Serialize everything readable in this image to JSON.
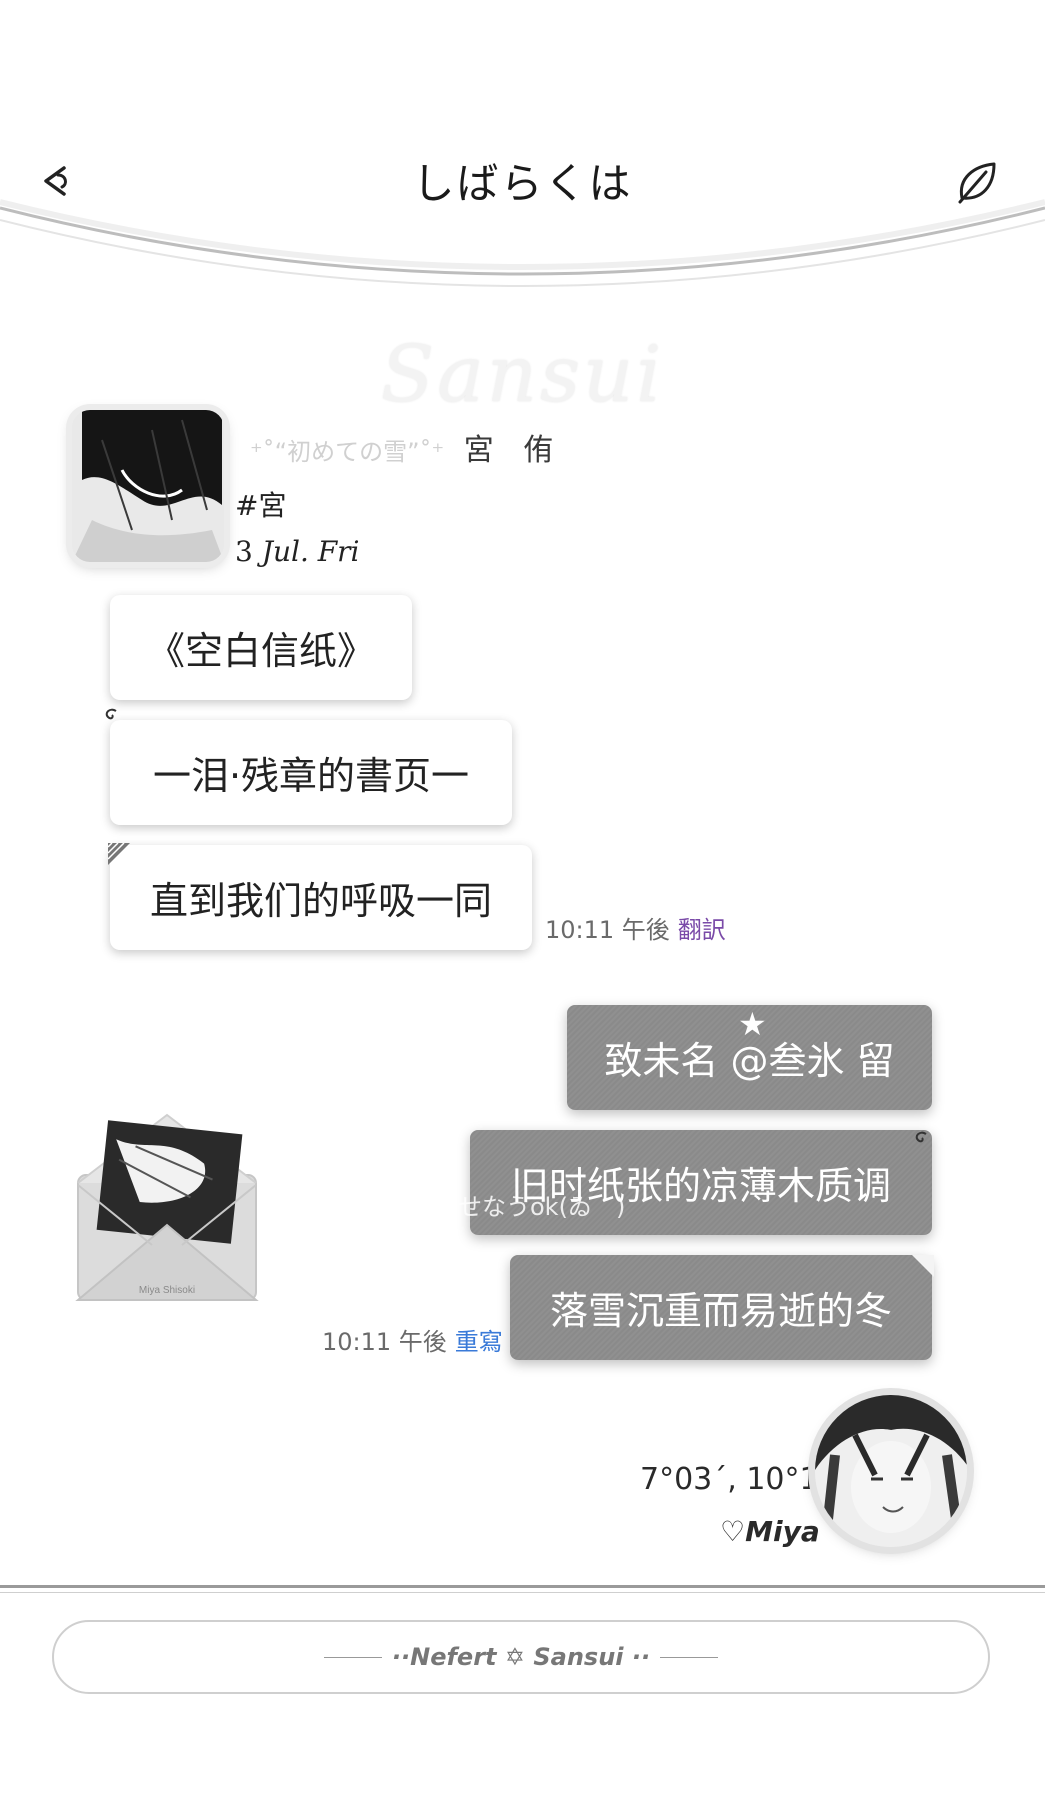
{
  "header": {
    "title": "しばらくは",
    "back_icon": "back-icon",
    "right_icon": "leaf-icon"
  },
  "watermark": "Sansui",
  "sender": {
    "deco": "⁺˚“初めての雪”˚⁺",
    "name": "宮 侑",
    "tag": "#宮",
    "date_day": "3",
    "date_rest": "Jul. Fri"
  },
  "received_messages": [
    {
      "text": "《空白信纸》"
    },
    {
      "text": "一泪·残章的書页一"
    },
    {
      "text": "直到我们的呼吸一同"
    }
  ],
  "received_meta": {
    "time": "10:11 午後",
    "action": "翻訳"
  },
  "sent_messages": [
    {
      "text": "致未名 @叁氷 留"
    },
    {
      "text": "旧时纸张的凉薄木质调"
    },
    {
      "text": "落雪沉重而易逝的冬"
    }
  ],
  "star": "★",
  "overlay_text": "せなうok(ゐ　)",
  "envelope_label": "Miya Shisoki",
  "sent_meta": {
    "time": "10:11 午後",
    "action": "重寫"
  },
  "self": {
    "coords": "7°03´, 10°11",
    "signature": "♡Miya"
  },
  "footer": {
    "input_text": "··Nefert ✡ Sansui ··"
  },
  "colors": {
    "sent_bubble": "#8c8c8c",
    "received_bubble": "#ffffff",
    "translate_action": "#7a4aa8",
    "rewrite_action": "#3a7ad8"
  }
}
